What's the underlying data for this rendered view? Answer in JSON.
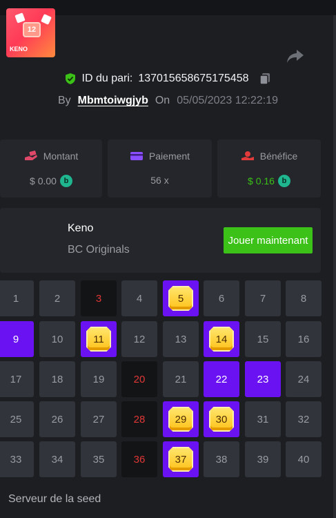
{
  "bet": {
    "id_label": "ID du pari:",
    "id_value": "137015658675175458",
    "by_label": "By",
    "username": "Mbmtoiwgjyb",
    "on_label": "On",
    "date": "05/05/2023 12:22:19"
  },
  "stats": [
    {
      "label": "Montant",
      "value": "$ 0.00",
      "coin": true,
      "icon": "hand-money-icon",
      "color": "#e0486a"
    },
    {
      "label": "Paiement",
      "value": "56 x",
      "coin": false,
      "icon": "card-icon",
      "color": "#8a4dff"
    },
    {
      "label": "Bénéfice",
      "value": "$ 0.16",
      "coin": true,
      "icon": "profit-icon",
      "color": "#e23b3b"
    }
  ],
  "game": {
    "name": "Keno",
    "provider": "BC Originals",
    "thumb_tile": "12",
    "thumb_label": "KENO",
    "play_label": "Jouer maintenant"
  },
  "board": {
    "numbers": [
      1,
      2,
      3,
      4,
      5,
      6,
      7,
      8,
      9,
      10,
      11,
      12,
      13,
      14,
      15,
      16,
      17,
      18,
      19,
      20,
      21,
      22,
      23,
      24,
      25,
      26,
      27,
      28,
      29,
      30,
      31,
      32,
      33,
      34,
      35,
      36,
      37,
      38,
      39,
      40
    ],
    "drawn": [
      3,
      20,
      28,
      36
    ],
    "picked": [
      9,
      22,
      23
    ],
    "hits": [
      5,
      11,
      14,
      29,
      30,
      37
    ]
  },
  "seed_label": "Serveur de la seed",
  "colors": {
    "accent_green": "#3bc117",
    "purple": "#6b12f2",
    "red": "#e13737",
    "coin": "#1fb58f"
  }
}
